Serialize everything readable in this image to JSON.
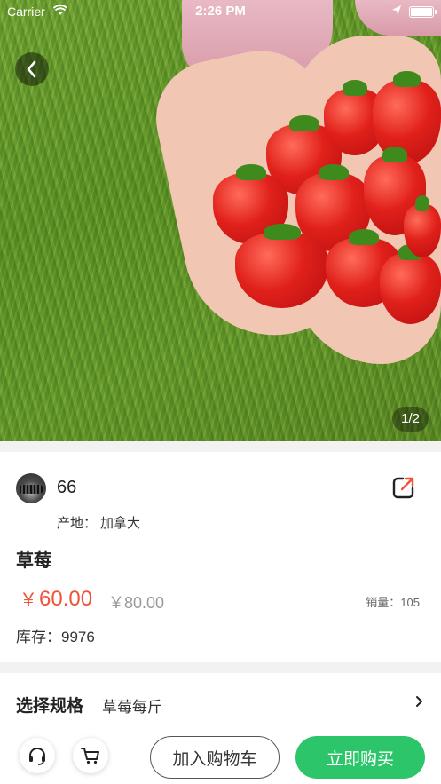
{
  "status_bar": {
    "carrier": "Carrier",
    "time": "2:26 PM"
  },
  "gallery": {
    "pager": "1/2"
  },
  "shop": {
    "name": "66"
  },
  "product": {
    "origin_label": "产地：",
    "origin_value": "加拿大",
    "title": "草莓",
    "currency": "￥",
    "price": "60.00",
    "old_price": "￥80.00",
    "sales": "销量：105",
    "stock": "库存：9976"
  },
  "spec": {
    "label": "选择规格",
    "value": "草莓每斤"
  },
  "actions": {
    "add_to_cart": "加入购物车",
    "buy_now": "立即购买"
  },
  "colors": {
    "accent": "#2dc56a",
    "price": "#f0533a"
  },
  "icons": [
    "back-arrow-icon",
    "share-icon",
    "headset-icon",
    "cart-icon",
    "chevron-right-icon"
  ]
}
